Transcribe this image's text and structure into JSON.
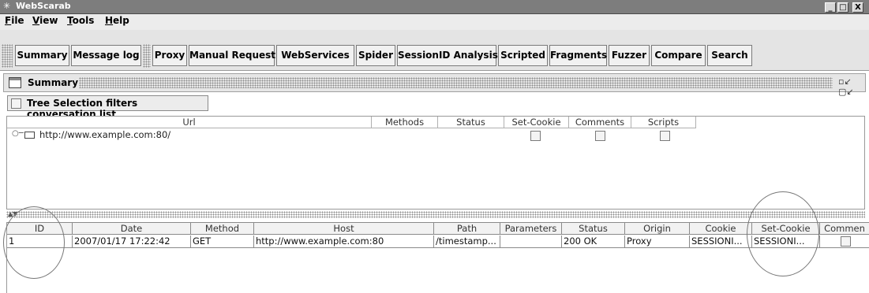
{
  "window": {
    "title": "WebScarab",
    "minimize": "_",
    "maximize": "□",
    "close": "X"
  },
  "menu": [
    {
      "label": "File",
      "mnemonic": "F",
      "rest": "ile"
    },
    {
      "label": "View",
      "mnemonic": "V",
      "rest": "iew"
    },
    {
      "label": "Tools",
      "mnemonic": "T",
      "rest": "ools"
    },
    {
      "label": "Help",
      "mnemonic": "H",
      "rest": "elp"
    }
  ],
  "toolbar": {
    "group1": [
      "Summary",
      "Message log"
    ],
    "group2": [
      "Proxy",
      "Manual Request",
      "WebServices",
      "Spider",
      "SessionID Analysis",
      "Scripted",
      "Fragments",
      "Fuzzer",
      "Compare",
      "Search"
    ]
  },
  "summary": {
    "title": "Summary"
  },
  "tree_filter": {
    "label": "Tree Selection filters conversation list",
    "checked": false
  },
  "url_table": {
    "columns": [
      "Url",
      "Methods",
      "Status",
      "Set-Cookie",
      "Comments",
      "Scripts"
    ],
    "rows": [
      {
        "url": "http://www.example.com:80/",
        "methods": "",
        "status": "",
        "set_cookie": false,
        "comments": false,
        "scripts": false
      }
    ]
  },
  "conversation_table": {
    "columns": [
      "ID",
      "Date",
      "Method",
      "Host",
      "Path",
      "Parameters",
      "Status",
      "Origin",
      "Cookie",
      "Set-Cookie",
      "Commen"
    ],
    "rows": [
      {
        "id": "1",
        "date": "2007/01/17 17:22:42",
        "method": "GET",
        "host": "http://www.example.com:80",
        "path": "/timestamp...",
        "parameters": "",
        "status": "200 OK",
        "origin": "Proxy",
        "cookie": "SESSIONI...",
        "set_cookie": "SESSIONI...",
        "comment": false
      }
    ]
  },
  "icons": [
    "app-icon",
    "summary-window-icon",
    "key-expander-icon",
    "folder-icon",
    "splitter-arrows-icon",
    "undock-icon"
  ]
}
